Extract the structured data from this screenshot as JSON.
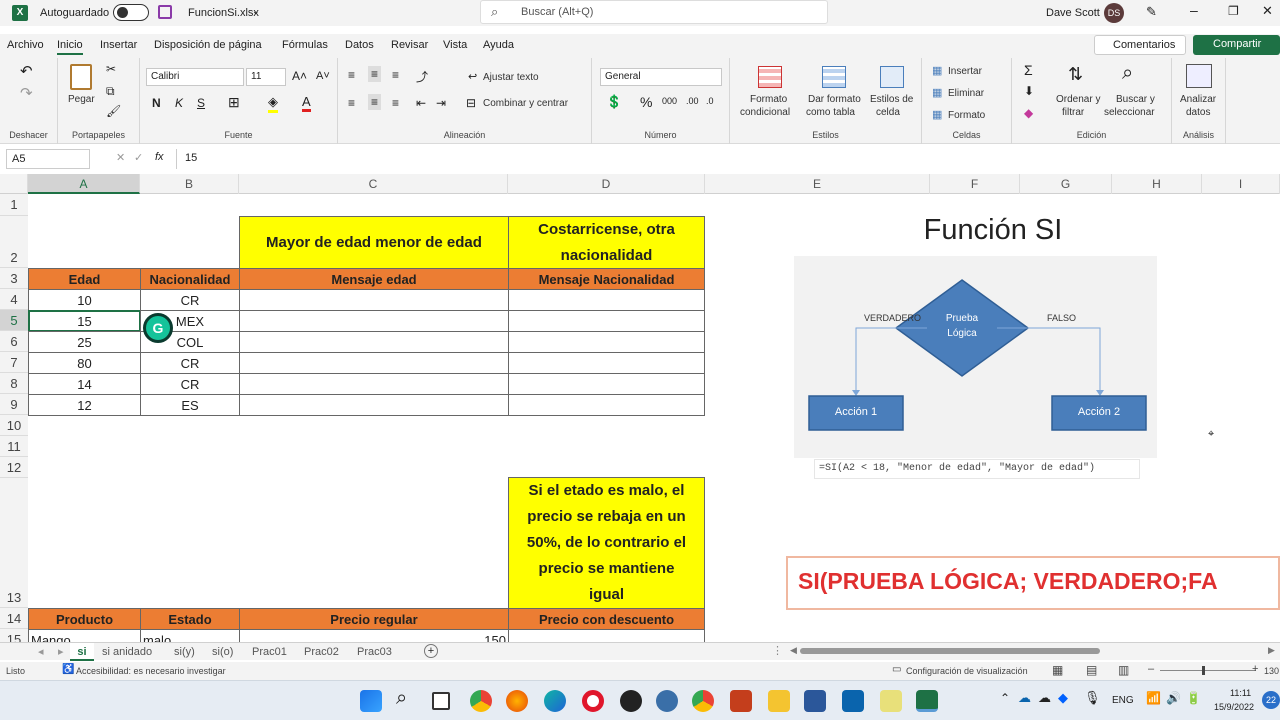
{
  "titlebar": {
    "autosave_label": "Autoguardado",
    "filename": "FuncionSi.xlsx",
    "search_placeholder": "Buscar (Alt+Q)",
    "user": "Dave Scott",
    "initials": "DS"
  },
  "menu": {
    "items": [
      "Archivo",
      "Inicio",
      "Insertar",
      "Disposición de página",
      "Fórmulas",
      "Datos",
      "Revisar",
      "Vista",
      "Ayuda"
    ],
    "active": "Inicio",
    "comments": "Comentarios",
    "share": "Compartir"
  },
  "ribbon": {
    "undo_group": "Deshacer",
    "clipboard": {
      "paste": "Pegar",
      "label": "Portapapeles"
    },
    "font": {
      "name": "Calibri",
      "size": "11",
      "bold": "N",
      "italic": "K",
      "underline": "S",
      "label": "Fuente"
    },
    "alignment": {
      "wrap": "Ajustar texto",
      "merge": "Combinar y centrar",
      "label": "Alineación"
    },
    "number": {
      "format": "General",
      "label": "Número"
    },
    "styles": {
      "cond_format_1": "Formato",
      "cond_format_2": "condicional",
      "table_format_1": "Dar formato",
      "table_format_2": "como tabla",
      "cell_styles_1": "Estilos de",
      "cell_styles_2": "celda",
      "label": "Estilos"
    },
    "cells": {
      "insert": "Insertar",
      "delete": "Eliminar",
      "format": "Formato",
      "label": "Celdas"
    },
    "editing": {
      "sort_1": "Ordenar y",
      "sort_2": "filtrar",
      "find_1": "Buscar y",
      "find_2": "seleccionar",
      "label": "Edición"
    },
    "analysis": {
      "analyze_1": "Analizar",
      "analyze_2": "datos",
      "label": "Análisis"
    }
  },
  "formulabar": {
    "namebox": "A5",
    "fx": "fx",
    "value": "15"
  },
  "columns": [
    "A",
    "B",
    "C",
    "D",
    "E",
    "F",
    "G",
    "H",
    "I"
  ],
  "rows": [
    "1",
    "2",
    "3",
    "4",
    "5",
    "6",
    "7",
    "8",
    "9",
    "10",
    "11",
    "12",
    "13",
    "14",
    "15"
  ],
  "table1": {
    "title_c": "Mayor de edad menor de edad",
    "title_d": "Costarricense, otra nacionalidad",
    "headers": [
      "Edad",
      "Nacionalidad",
      "Mensaje edad",
      "Mensaje Nacionalidad"
    ],
    "rows": [
      [
        "10",
        "CR"
      ],
      [
        "15",
        "MEX"
      ],
      [
        "25",
        "COL"
      ],
      [
        "80",
        "CR"
      ],
      [
        "14",
        "CR"
      ],
      [
        "12",
        "ES"
      ]
    ]
  },
  "table2": {
    "note": "Si el etado es malo, el precio se rebaja en un 50%, de lo contrario el precio se mantiene igual",
    "headers": [
      "Producto",
      "Estado",
      "Precio regular",
      "Precio con descuento"
    ],
    "row": [
      "Mango",
      "malo",
      "150"
    ]
  },
  "diagram": {
    "title": "Función SI",
    "test_1": "Prueba",
    "test_2": "Lógica",
    "true_label": "VERDADERO",
    "false_label": "FALSO",
    "action1": "Acción 1",
    "action2": "Acción 2",
    "formula": "=SI(A2 < 18, \"Menor de edad\", \"Mayor de edad\")"
  },
  "syntax_banner": "SI(PRUEBA LÓGICA; VERDADERO;FA",
  "sheets": [
    "si",
    "si anidado",
    "si(y)",
    "si(o)",
    "Prac01",
    "Prac02",
    "Prac03"
  ],
  "active_sheet": "si",
  "status": {
    "ready": "Listo",
    "accessibility": "Accesibilidad: es necesario investigar",
    "view_settings": "Configuración de visualización",
    "zoom": "130"
  },
  "taskbar": {
    "lang": "ENG",
    "time": "11:11",
    "date": "15/9/2022",
    "notif": "22"
  },
  "colors": {
    "excel_green": "#1e7145",
    "header_orange": "#ec7d33",
    "highlight_yellow": "#ffff00",
    "diagram_blue": "#4a7ebb",
    "banner_red": "#e03030"
  }
}
